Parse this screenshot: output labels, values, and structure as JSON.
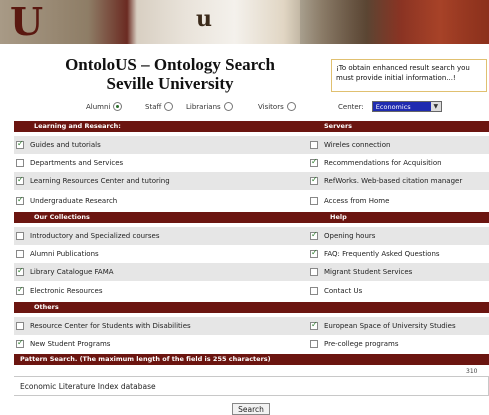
{
  "banner": {
    "letter_left": "U",
    "letter_mid": "u"
  },
  "header": {
    "title_line1": "OntoloUS – Ontology Search",
    "title_line2": "Seville University"
  },
  "note": "¡To obtain enhanced result search you must provide initial information...!",
  "roles": [
    {
      "label": "Alumni",
      "selected": true
    },
    {
      "label": "Staff",
      "selected": false
    },
    {
      "label": "Librarians",
      "selected": false
    },
    {
      "label": "Visitors",
      "selected": false
    }
  ],
  "center": {
    "label": "Center:",
    "value": "Economics"
  },
  "sections": [
    {
      "left": "Learning and Research:",
      "right": "Servers"
    },
    {
      "left": "Our Collections",
      "right": "Help"
    },
    {
      "left": "Others",
      "right": ""
    },
    {
      "left": "Pattern Search. (The maximum length of the field is 255 characters)",
      "right": ""
    }
  ],
  "rows": [
    {
      "left": {
        "label": "Guides and tutorials",
        "checked": true
      },
      "right": {
        "label": "Wireles connection",
        "checked": false
      }
    },
    {
      "left": {
        "label": "Departments and Services",
        "checked": false
      },
      "right": {
        "label": "Recommendations for Acquisition",
        "checked": true
      }
    },
    {
      "left": {
        "label": "Learning Resources Center and tutoring",
        "checked": true
      },
      "right": {
        "label": "RefWorks. Web-based citation manager",
        "checked": true
      }
    },
    {
      "left": {
        "label": "Undergraduate Research",
        "checked": true
      },
      "right": {
        "label": "Access from Home",
        "checked": false
      }
    },
    {
      "left": {
        "label": "Introductory and Specialized courses",
        "checked": false
      },
      "right": {
        "label": "Opening hours",
        "checked": true
      }
    },
    {
      "left": {
        "label": "Alumni Publications",
        "checked": false
      },
      "right": {
        "label": "FAQ: Frequently Asked Questions",
        "checked": true
      }
    },
    {
      "left": {
        "label": "Library Catalogue FAMA",
        "checked": true
      },
      "right": {
        "label": "Migrant Student Services",
        "checked": false
      }
    },
    {
      "left": {
        "label": "Electronic Resources",
        "checked": true
      },
      "right": {
        "label": "Contact Us",
        "checked": false
      }
    },
    {
      "left": {
        "label": "Resource Center for Students with Disabilities",
        "checked": false
      },
      "right": {
        "label": "European Space of University Studies",
        "checked": true
      }
    },
    {
      "left": {
        "label": "New Student Programs",
        "checked": true
      },
      "right": {
        "label": "Pre-college programs",
        "checked": false
      }
    }
  ],
  "search": {
    "counter": "310",
    "value": "Economic Literature Index database",
    "button": "Search"
  }
}
